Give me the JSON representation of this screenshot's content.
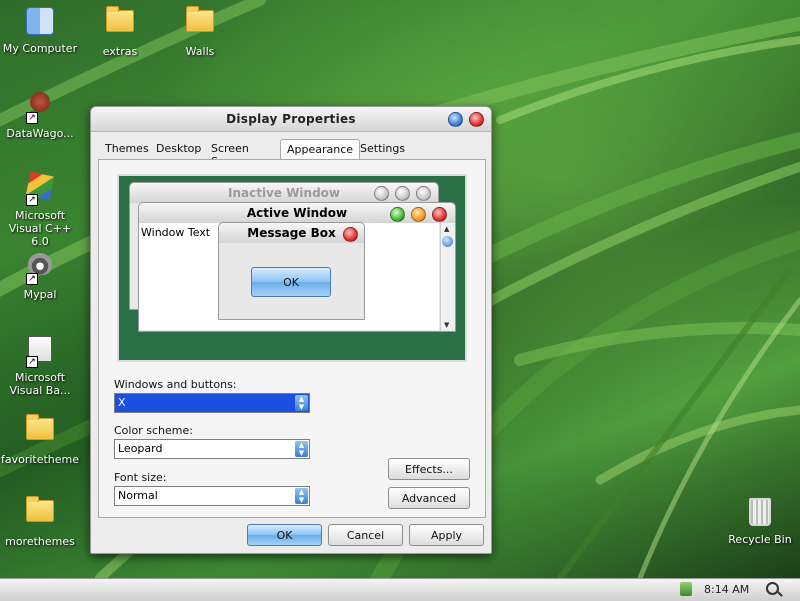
{
  "desktop": {
    "icons": [
      {
        "label": "My Computer"
      },
      {
        "label": "extras"
      },
      {
        "label": "Walls"
      },
      {
        "label": "DataWago..."
      },
      {
        "label": "Microsoft Visual C++ 6.0"
      },
      {
        "label": "Mypal"
      },
      {
        "label": "Microsoft Visual Ba..."
      },
      {
        "label": "favoritetheme"
      },
      {
        "label": "morethemes"
      },
      {
        "label": "Recycle Bin"
      }
    ]
  },
  "window": {
    "title": "Display Properties",
    "tabs": [
      "Themes",
      "Desktop",
      "Screen Saver",
      "Appearance",
      "Settings"
    ],
    "active_tab": "Appearance",
    "preview": {
      "inactive_title": "Inactive Window",
      "active_title": "Active Window",
      "window_text": "Window Text",
      "message_title": "Message Box",
      "message_ok": "OK"
    },
    "fields": {
      "windows_buttons_label": "Windows and buttons:",
      "windows_buttons_value": "X",
      "color_scheme_label": "Color scheme:",
      "color_scheme_value": "Leopard",
      "font_size_label": "Font size:",
      "font_size_value": "Normal"
    },
    "buttons": {
      "effects": "Effects...",
      "advanced": "Advanced",
      "ok": "OK",
      "cancel": "Cancel",
      "apply": "Apply"
    }
  },
  "taskbar": {
    "clock": "8:14 AM"
  },
  "colors": {
    "preview_bg": "#2a7046",
    "selection": "#1a4fe0",
    "accent_blue": "#69aee9"
  }
}
